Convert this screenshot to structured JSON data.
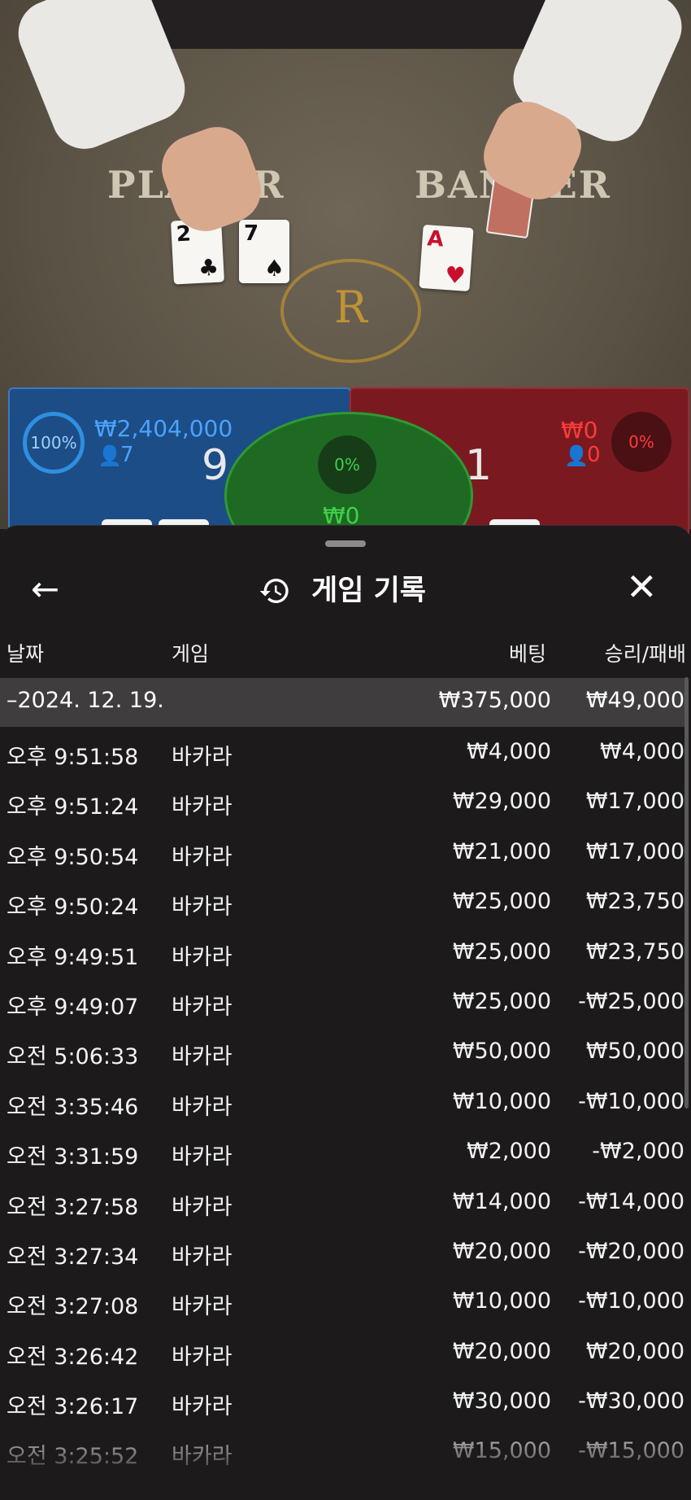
{
  "video": {
    "player_label": "PLAYER",
    "banker_label": "BANKER",
    "crest_letter": "R",
    "player_cards": [
      {
        "rank": "2",
        "suit": "♣",
        "color": "black"
      },
      {
        "rank": "7",
        "suit": "♠",
        "color": "black"
      }
    ],
    "banker_cards": [
      {
        "rank": "A",
        "suit": "♥",
        "color": "red"
      }
    ]
  },
  "bet_panel": {
    "player": {
      "percent": "100%",
      "amount": "₩2,404,000",
      "bettors": "7",
      "score": "9"
    },
    "tie": {
      "percent": "0%",
      "amount": "₩0"
    },
    "banker": {
      "percent": "0%",
      "amount": "₩0",
      "bettors": "0",
      "score": "1"
    }
  },
  "sheet": {
    "title": "게임 기록",
    "icons": {
      "back": "arrow-left-icon",
      "history": "history-icon",
      "close": "close-icon"
    },
    "back_symbol": "←",
    "close_symbol": "✕",
    "columns": {
      "date": "날짜",
      "game": "게임",
      "bet": "베팅",
      "result": "승리/패배"
    },
    "date_group": {
      "label": "–2024. 12. 19.",
      "bet_total": "₩375,000",
      "result_total": "₩49,000"
    },
    "rows": [
      {
        "time": "오후 9:51:58",
        "game": "바카라",
        "bet": "₩4,000",
        "result": "₩4,000"
      },
      {
        "time": "오후 9:51:24",
        "game": "바카라",
        "bet": "₩29,000",
        "result": "₩17,000"
      },
      {
        "time": "오후 9:50:54",
        "game": "바카라",
        "bet": "₩21,000",
        "result": "₩17,000"
      },
      {
        "time": "오후 9:50:24",
        "game": "바카라",
        "bet": "₩25,000",
        "result": "₩23,750"
      },
      {
        "time": "오후 9:49:51",
        "game": "바카라",
        "bet": "₩25,000",
        "result": "₩23,750"
      },
      {
        "time": "오후 9:49:07",
        "game": "바카라",
        "bet": "₩25,000",
        "result": "-₩25,000"
      },
      {
        "time": "오전 5:06:33",
        "game": "바카라",
        "bet": "₩50,000",
        "result": "₩50,000"
      },
      {
        "time": "오전 3:35:46",
        "game": "바카라",
        "bet": "₩10,000",
        "result": "-₩10,000"
      },
      {
        "time": "오전 3:31:59",
        "game": "바카라",
        "bet": "₩2,000",
        "result": "-₩2,000"
      },
      {
        "time": "오전 3:27:58",
        "game": "바카라",
        "bet": "₩14,000",
        "result": "-₩14,000"
      },
      {
        "time": "오전 3:27:34",
        "game": "바카라",
        "bet": "₩20,000",
        "result": "-₩20,000"
      },
      {
        "time": "오전 3:27:08",
        "game": "바카라",
        "bet": "₩10,000",
        "result": "-₩10,000"
      },
      {
        "time": "오전 3:26:42",
        "game": "바카라",
        "bet": "₩20,000",
        "result": "₩20,000"
      },
      {
        "time": "오전 3:26:17",
        "game": "바카라",
        "bet": "₩30,000",
        "result": "-₩30,000"
      },
      {
        "time": "오전 3:25:52",
        "game": "바카라",
        "bet": "₩15,000",
        "result": "-₩15,000"
      }
    ]
  },
  "colors": {
    "player_blue": "#1c4d86",
    "banker_red": "#7a1a20",
    "tie_green": "#1f6a23",
    "sheet_bg": "#1c1a1b",
    "date_row_bg": "#3f3d3e"
  }
}
